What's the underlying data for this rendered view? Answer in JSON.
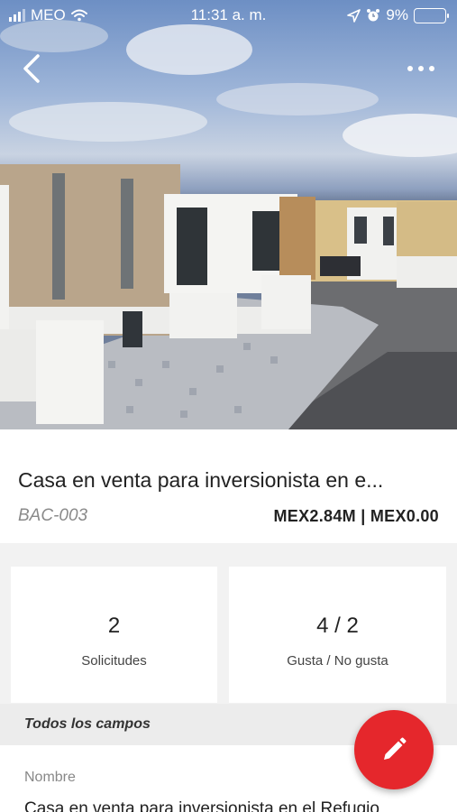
{
  "status_bar": {
    "carrier": "MEO",
    "time": "11:31 a. m.",
    "battery_percent": "9%",
    "battery_level": 0.09,
    "battery_color": "#f3c623"
  },
  "header": {
    "back_icon": "chevron-left-icon",
    "more_icon": "more-horizontal-icon"
  },
  "listing": {
    "title": "Casa en venta para inversionista en e...",
    "code": "BAC-003",
    "price": "MEX2.84M | MEX0.00"
  },
  "stats": [
    {
      "value": "2",
      "label": "Solicitudes"
    },
    {
      "value": "4 / 2",
      "label": "Gusta / No gusta"
    }
  ],
  "section": {
    "title": "Todos los campos"
  },
  "fields": [
    {
      "label": "Nombre",
      "value": "Casa en venta para inversionista en el Refugio"
    }
  ],
  "fab": {
    "icon": "pencil-icon",
    "color": "#e5272c"
  }
}
